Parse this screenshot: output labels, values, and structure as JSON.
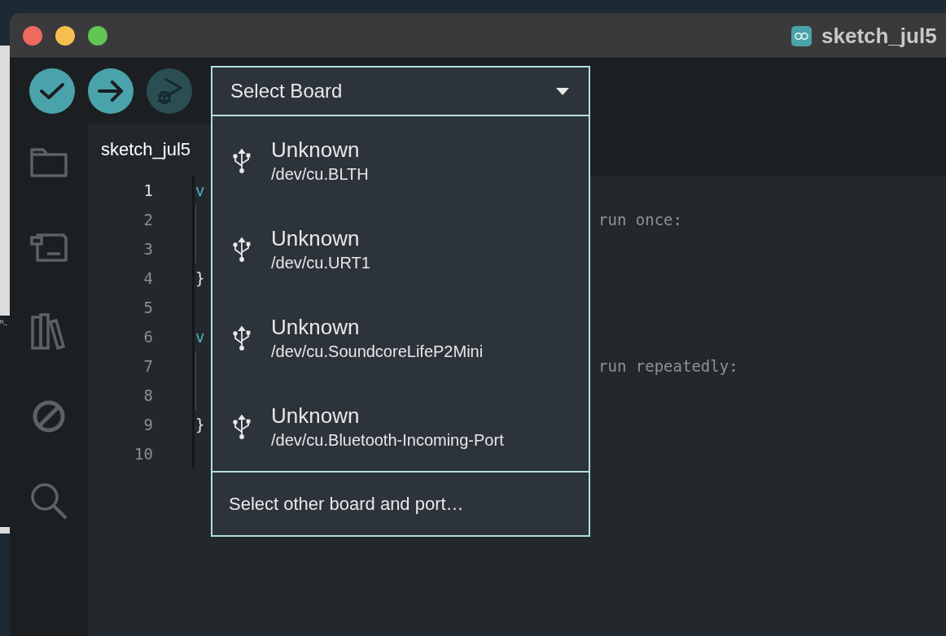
{
  "background_window": {
    "text": "h_"
  },
  "window": {
    "title": "sketch_jul5"
  },
  "toolbar": {
    "buttons": [
      {
        "kind": "verify",
        "disabled": false
      },
      {
        "kind": "upload",
        "disabled": false
      },
      {
        "kind": "debug",
        "disabled": true
      }
    ]
  },
  "sidebar": {
    "items": [
      {
        "kind": "sketchbook"
      },
      {
        "kind": "boards"
      },
      {
        "kind": "library"
      },
      {
        "kind": "debug"
      },
      {
        "kind": "search"
      }
    ]
  },
  "editor": {
    "tab": "sketch_jul5",
    "lines": [
      {
        "number": "1",
        "current": true,
        "kind": "keyword",
        "code": "v"
      },
      {
        "number": "2",
        "current": false,
        "kind": "body",
        "comment": "run once:"
      },
      {
        "number": "3",
        "current": false,
        "kind": "body"
      },
      {
        "number": "4",
        "current": false,
        "kind": "brace",
        "code": "}"
      },
      {
        "number": "5",
        "current": false,
        "kind": "blank"
      },
      {
        "number": "6",
        "current": false,
        "kind": "keyword",
        "code": "v"
      },
      {
        "number": "7",
        "current": false,
        "kind": "body",
        "comment": "run repeatedly:"
      },
      {
        "number": "8",
        "current": false,
        "kind": "body"
      },
      {
        "number": "9",
        "current": false,
        "kind": "brace",
        "code": "}"
      },
      {
        "number": "10",
        "current": false,
        "kind": "blank"
      }
    ]
  },
  "board_selector": {
    "label": "Select Board",
    "expanded": true,
    "ports": [
      {
        "name": "Unknown",
        "path": "/dev/cu.BLTH"
      },
      {
        "name": "Unknown",
        "path": "/dev/cu.URT1"
      },
      {
        "name": "Unknown",
        "path": "/dev/cu.SoundcoreLifeP2Mini"
      },
      {
        "name": "Unknown",
        "path": "/dev/cu.Bluetooth-Incoming-Port"
      }
    ],
    "footer": "Select other board and port…"
  }
}
